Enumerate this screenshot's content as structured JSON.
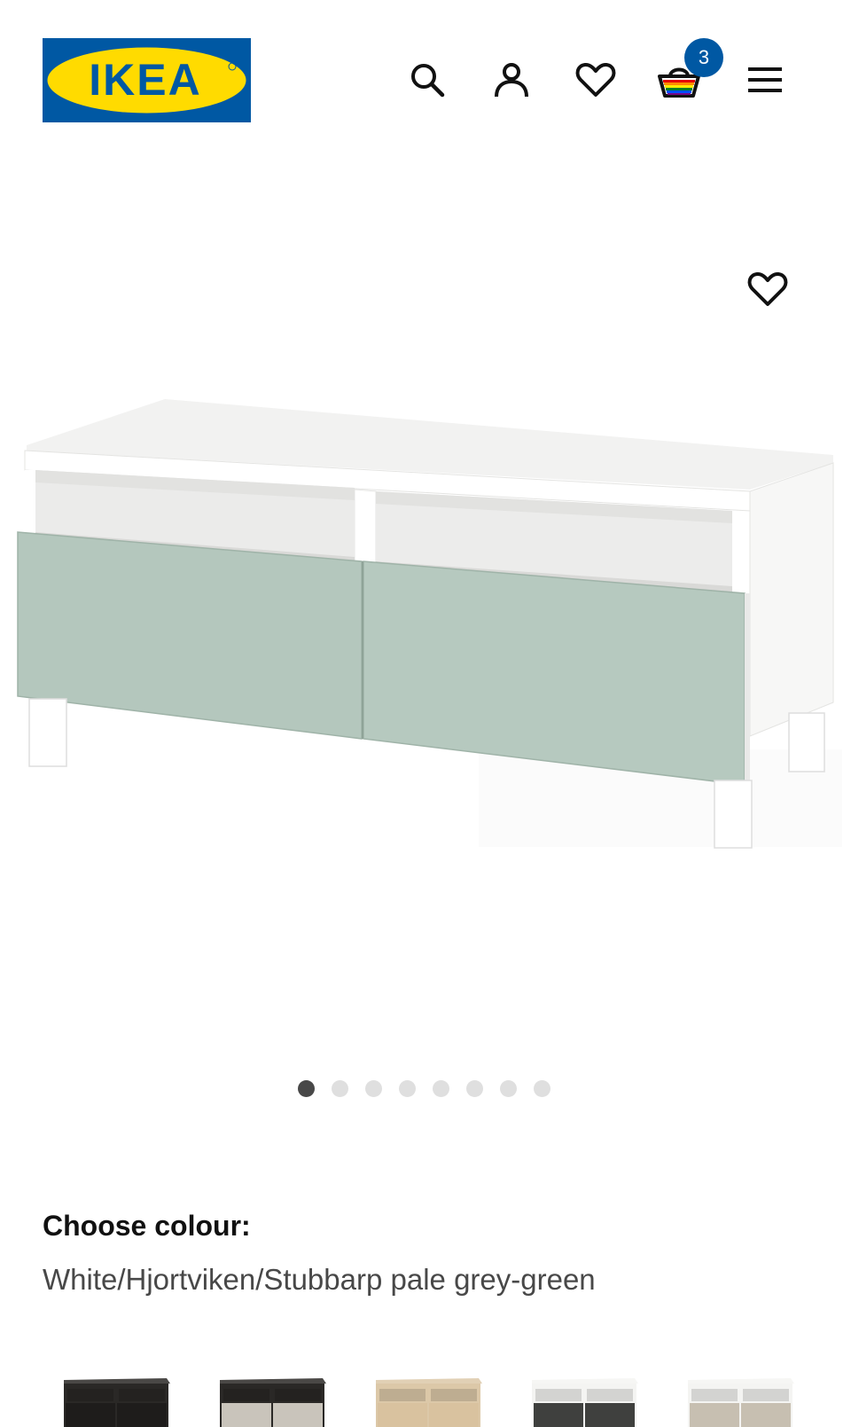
{
  "header": {
    "logo_text": "IKEA",
    "cart_count": "3",
    "icons": [
      "search-icon",
      "account-icon",
      "favourites-icon",
      "cart-icon",
      "menu-icon"
    ]
  },
  "product": {
    "carousel": {
      "total_images": 8,
      "active_index": 0
    },
    "favourite_icon": "heart-outline-icon"
  },
  "colour": {
    "title": "Choose colour:",
    "selected": "White/Hjortviken/Stubbarp pale grey-green",
    "swatches": [
      {
        "name": "black-brown",
        "body": "#2a2826",
        "front": "#1e1c1b"
      },
      {
        "name": "black-brown/light grey",
        "body": "#2a2826",
        "front": "#c9c4bb"
      },
      {
        "name": "white stained oak effect",
        "body": "#dcc8a8",
        "front": "#d9c29f"
      },
      {
        "name": "white/dark grey",
        "body": "#f4f4f2",
        "front": "#3f403e"
      },
      {
        "name": "white/beige",
        "body": "#f4f4f2",
        "front": "#c7bfb1"
      }
    ]
  },
  "colors": {
    "brand_blue": "#0058a3",
    "brand_yellow": "#ffdb00",
    "front_green": "#b4c7bd"
  }
}
